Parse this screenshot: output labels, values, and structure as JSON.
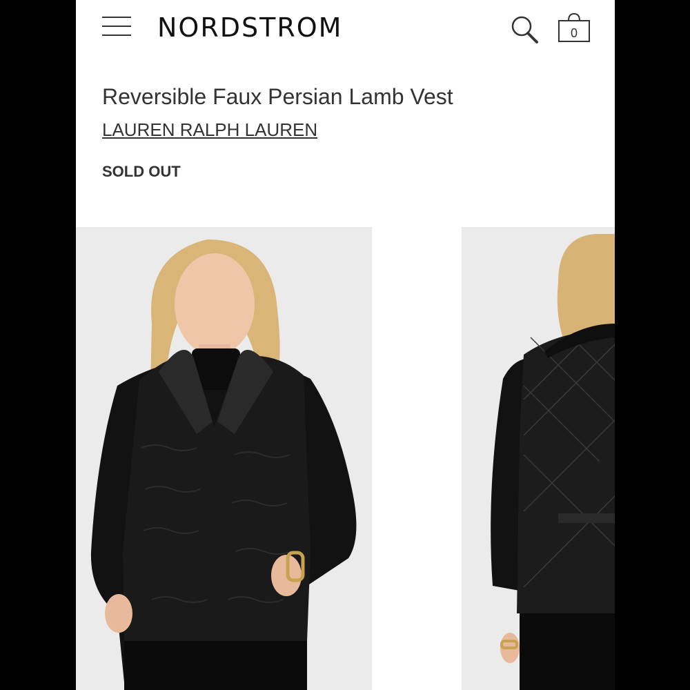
{
  "header": {
    "logo": "NORDSTROM",
    "menu_icon": "hamburger-menu-icon",
    "search_icon": "search-icon",
    "bag_icon": "shopping-bag-icon",
    "bag_count": "0"
  },
  "product": {
    "title": "Reversible Faux Persian Lamb Vest",
    "brand": "LAUREN RALPH LAUREN",
    "status": "SOLD OUT"
  },
  "gallery": {
    "images": [
      {
        "view": "front"
      },
      {
        "view": "back"
      }
    ]
  },
  "colors": {
    "background": "#ffffff",
    "text": "#333333",
    "photo_bg": "#ebebec",
    "garment": "#141414"
  }
}
